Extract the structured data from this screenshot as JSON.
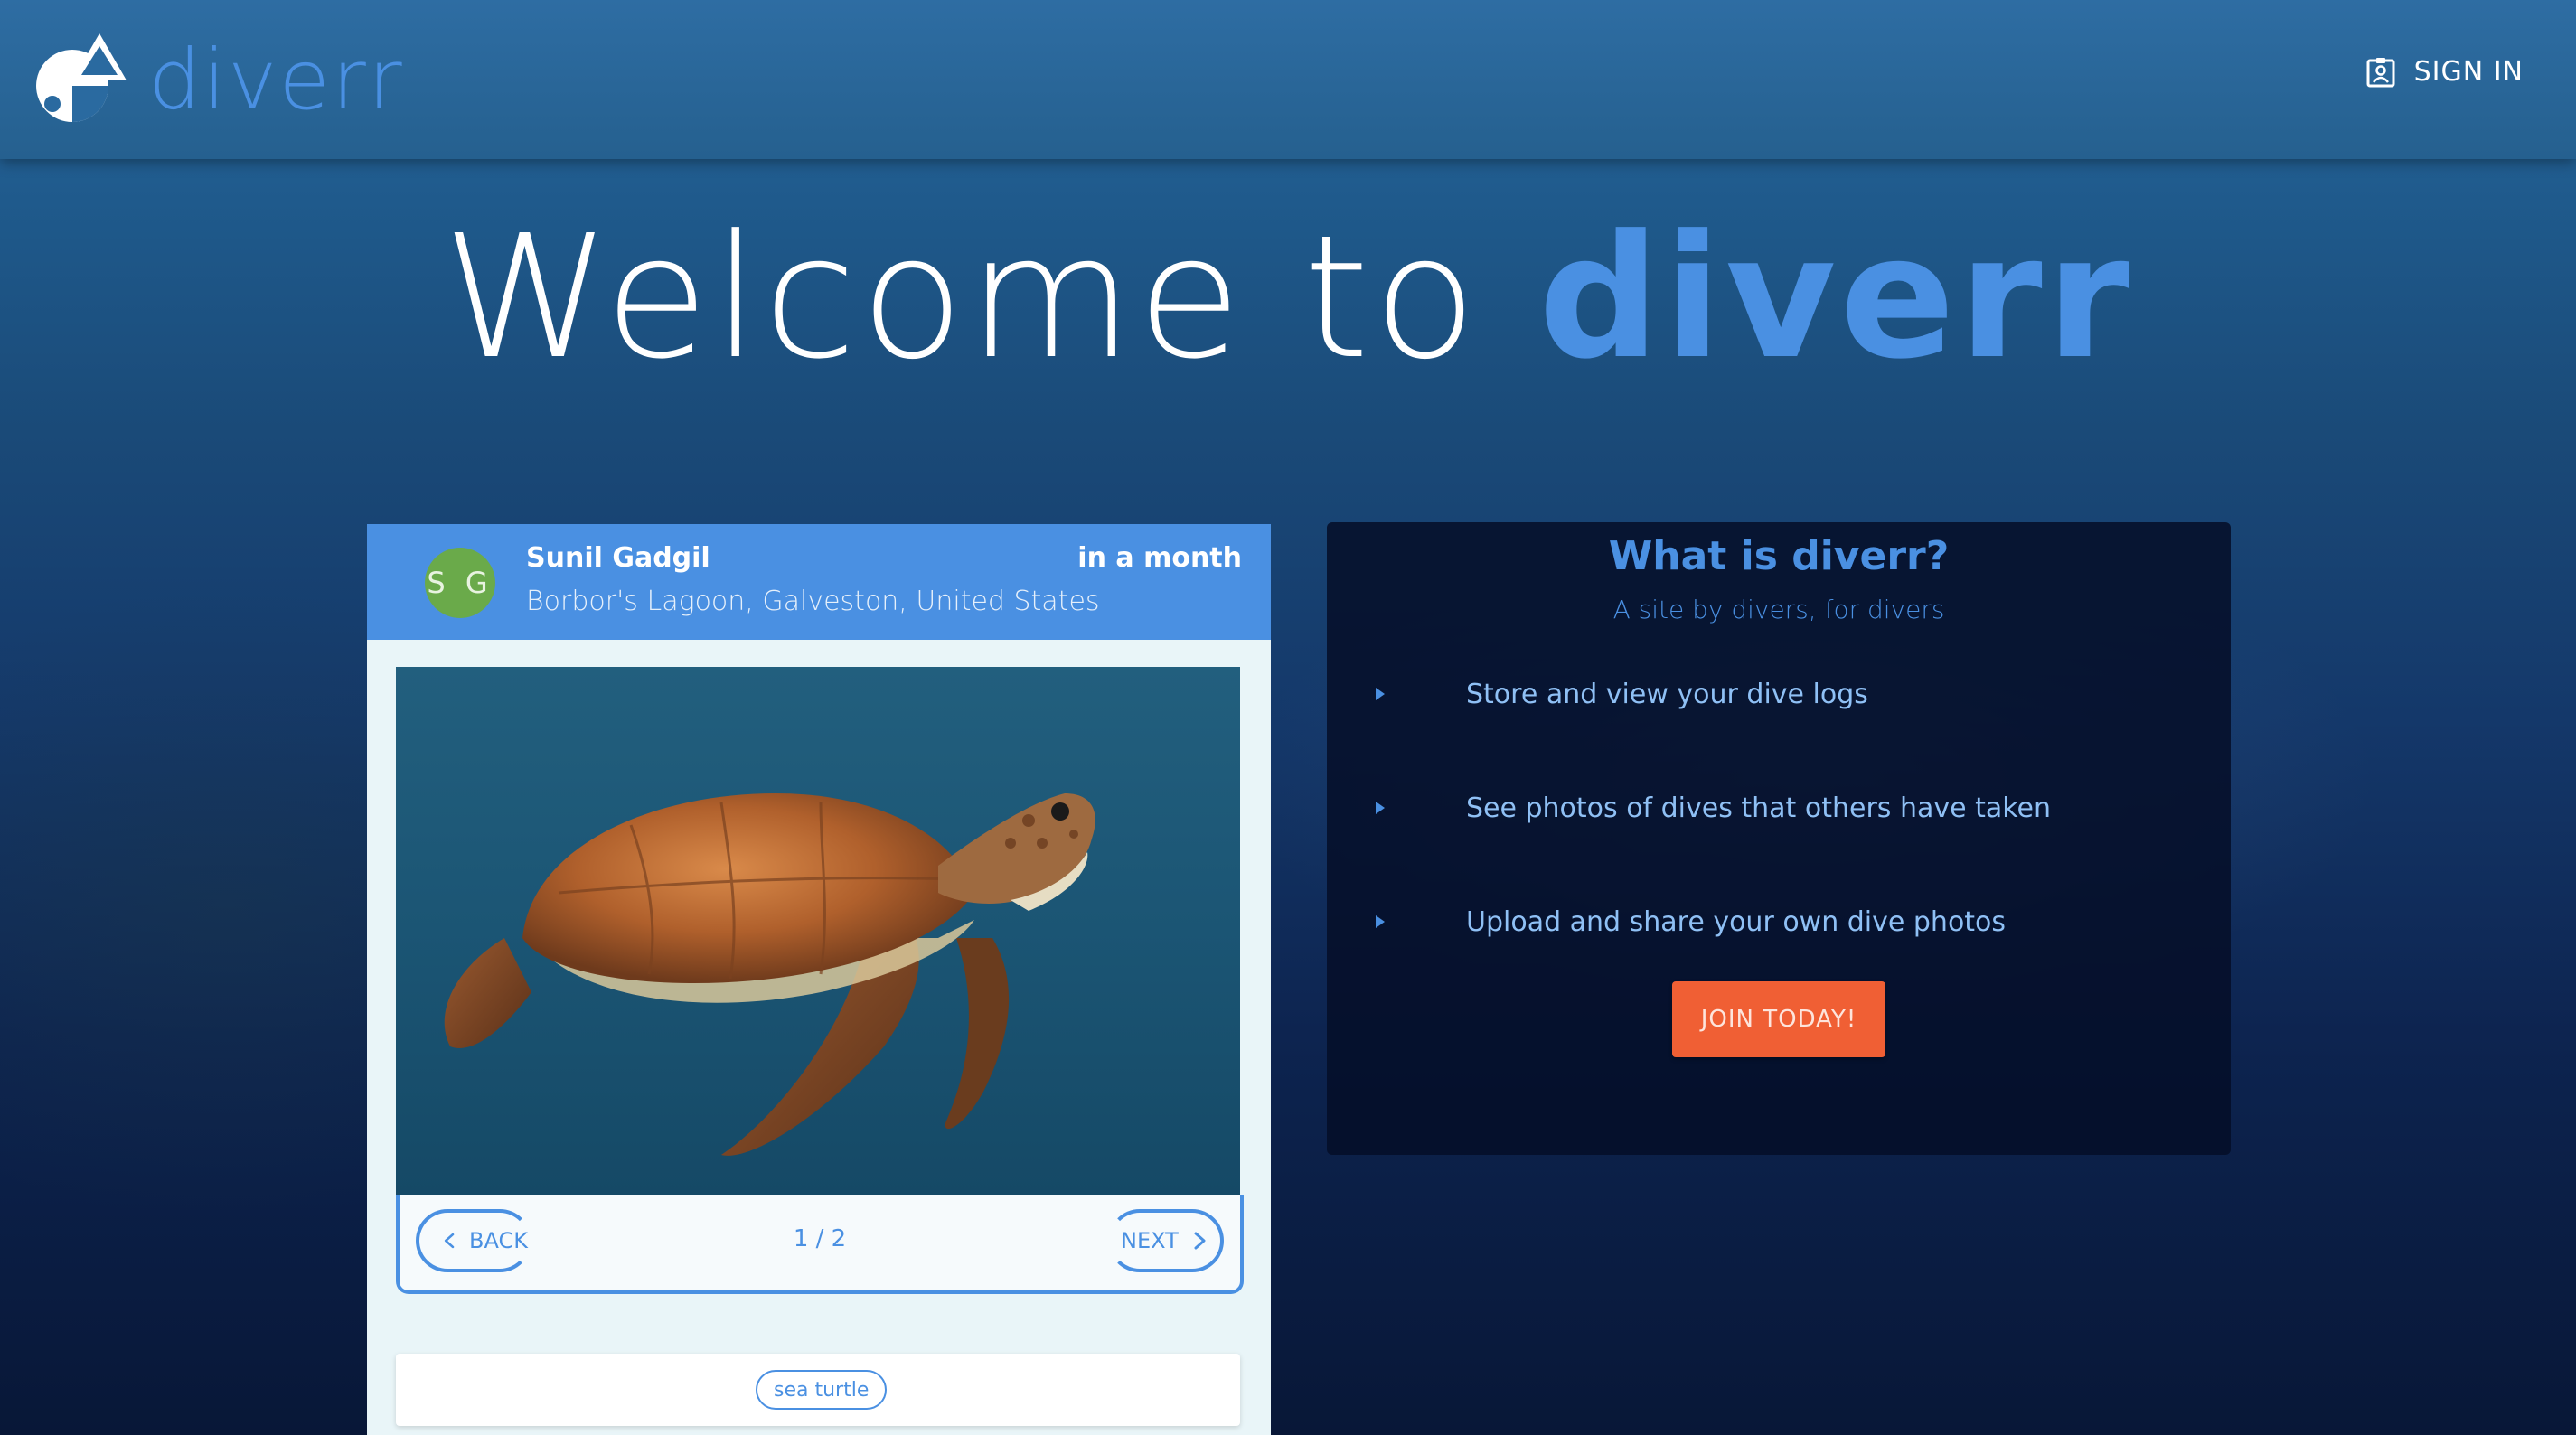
{
  "header": {
    "brand_name": "diverr",
    "sign_in_label": "SIGN IN"
  },
  "hero": {
    "prefix": "Welcome to",
    "accent": "diverr"
  },
  "dive_card": {
    "avatar_initials": "S G",
    "diver_name": "Sunil Gadgil",
    "location": "Borbor's Lagoon, Galveston, United States",
    "time": "in a month",
    "back_label": "BACK",
    "next_label": "NEXT",
    "page_indicator": "1 / 2",
    "tags": [
      "sea turtle"
    ]
  },
  "info": {
    "title": "What is diverr?",
    "subtitle": "A site by divers, for divers",
    "features": [
      "Store and view your dive logs",
      "See photos of dives that others have taken",
      "Upload and share your own dive photos"
    ],
    "cta_label": "JOIN TODAY!"
  },
  "colors": {
    "accent": "#4a90e2",
    "cta": "#f05f34",
    "avatar": "#6aaa4a"
  },
  "icons": {
    "logo": "diverr-logo-icon",
    "sign_in": "id-badge-icon",
    "back": "chevron-left-icon",
    "next": "chevron-right-icon",
    "bullet": "caret-right-icon"
  }
}
